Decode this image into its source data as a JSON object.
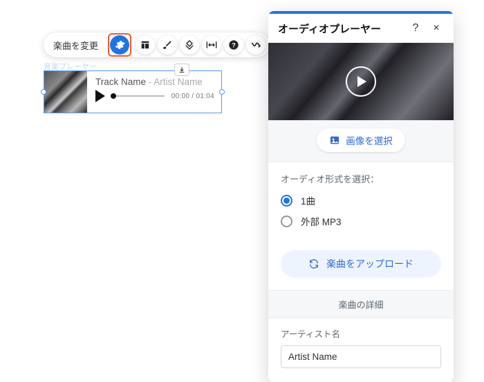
{
  "toolbar": {
    "change_track": "楽曲を変更"
  },
  "widget": {
    "label": "音楽プレーヤー",
    "track_name": "Track Name",
    "separator": " - ",
    "artist_name": "Artist Name",
    "time": "00:00 / 01:04"
  },
  "panel": {
    "title": "オーディオプレーヤー",
    "help": "?",
    "close": "×",
    "select_image": "画像を選択",
    "audio_format_label": "オーディオ形式を選択：",
    "radio_single": "1曲",
    "radio_external": "外部 MP3",
    "upload": "楽曲をアップロード",
    "details_header": "楽曲の詳細",
    "artist_label": "アーティスト名",
    "artist_value": "Artist Name"
  }
}
